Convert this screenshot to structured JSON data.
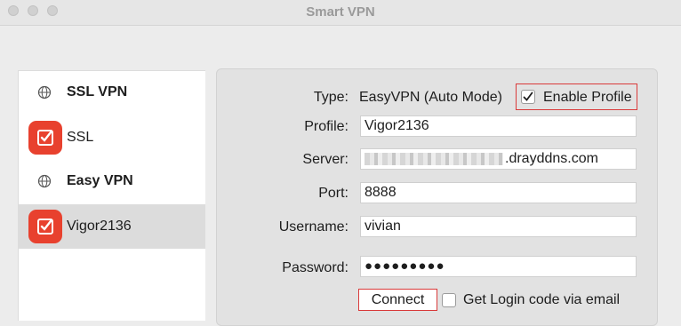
{
  "window": {
    "title": "Smart VPN"
  },
  "sidebar": {
    "groups": [
      {
        "header": "SSL VPN",
        "items": [
          {
            "label": "SSL",
            "selected": false
          }
        ]
      },
      {
        "header": "Easy VPN",
        "items": [
          {
            "label": "Vigor2136",
            "selected": true
          }
        ]
      }
    ]
  },
  "form": {
    "type_label": "Type:",
    "type_value": "EasyVPN (Auto Mode)",
    "enable_profile_label": "Enable Profile",
    "enable_profile_checked": true,
    "profile_label": "Profile:",
    "profile_value": "Vigor2136",
    "server_label": "Server:",
    "server_value_suffix": ".drayddns.com",
    "port_label": "Port:",
    "port_value": "8888",
    "username_label": "Username:",
    "username_value": "vivian",
    "password_label": "Password:",
    "password_mask": "●●●●●●●●●",
    "connect_label": "Connect",
    "login_code_label": "Get Login code via email",
    "login_code_checked": false
  },
  "colors": {
    "accent": "#e8412e",
    "highlight_box": "#d93a3a"
  }
}
